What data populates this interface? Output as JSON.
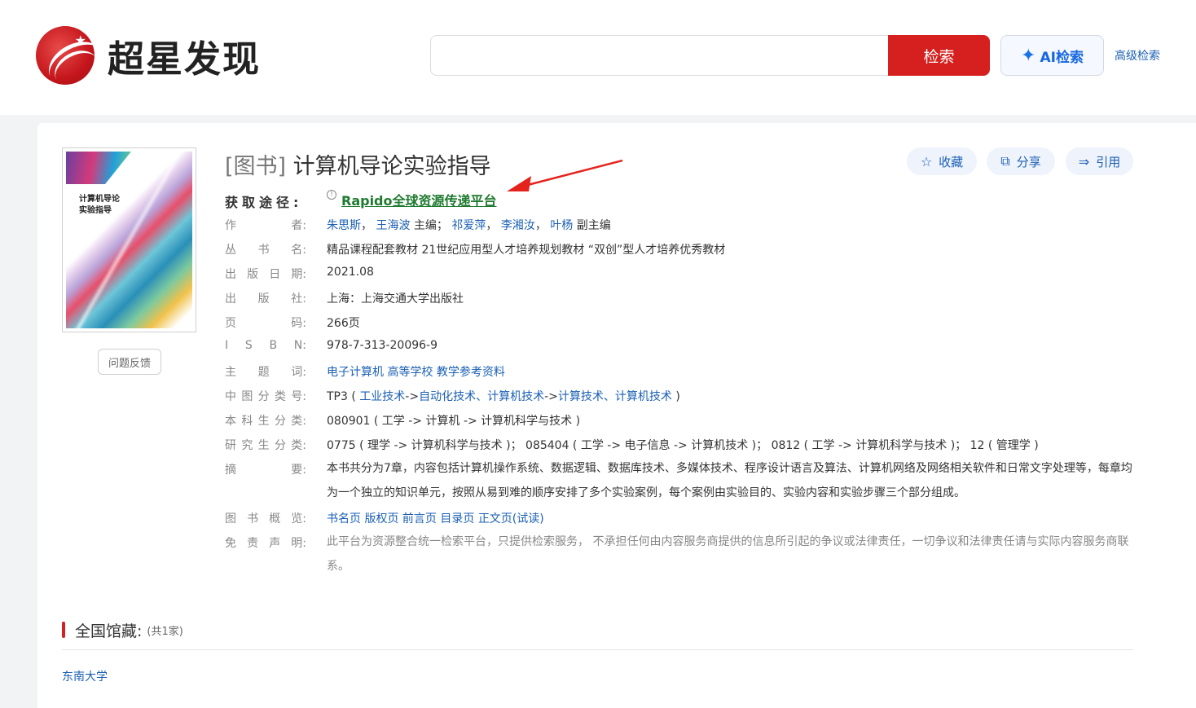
{
  "header": {
    "logo_text": "超星发现",
    "search_placeholder": "",
    "search_button": "检索",
    "ai_button": "AI检索",
    "advanced_link": "高级检索"
  },
  "book": {
    "type": "[图书]",
    "title": "计算机导论实验指导",
    "actions": {
      "favorite": "收藏",
      "share": "分享",
      "cite": "引用"
    },
    "access_label": "获取途径:",
    "access_link": "Rapido全球资源传递平台",
    "feedback_button": "问题反馈",
    "cover_title_line1": "计算机导论",
    "cover_title_line2": "实验指导",
    "fields": {
      "author_label": "作　者:",
      "authors": [
        {
          "name": "朱思斯",
          "sep": "，"
        },
        {
          "name": "王海波",
          "sep": " 主编；"
        },
        {
          "name": "祁爱萍",
          "sep": "，"
        },
        {
          "name": "李湘汝",
          "sep": "，"
        },
        {
          "name": "叶杨",
          "sep": " 副主编"
        }
      ],
      "series_label": "丛书名:",
      "series": "精品课程配套教材 21世纪应用型人才培养规划教材 “双创”型人才培养优秀教材",
      "date_label": "出版日期:",
      "date": "2021.08",
      "publisher_label": "出版社:",
      "publisher": "上海：上海交通大学出版社",
      "pages_label": "页码:",
      "pages": "266页",
      "isbn_label": "ISBN:",
      "isbn": "978-7-313-20096-9",
      "subject_label": "主题词:",
      "subjects": [
        "电子计算机",
        "高等学校",
        "教学参考资料"
      ],
      "clc_label": "中图分类号:",
      "clc_code": "TP3",
      "clc_parts": [
        "工业技术",
        "->",
        "自动化技术、计算机技术",
        "->",
        "计算技术、计算机技术"
      ],
      "ug_label": "本科生分类:",
      "ug": "080901 ( 工学 -> 计算机 -> 计算机科学与技术 )",
      "pg_label": "研究生分类:",
      "pg": "0775 ( 理学 -> 计算机科学与技术 )；  085404 ( 工学 -> 电子信息 -> 计算机技术 )；  0812 ( 工学 -> 计算机科学与技术 )；  12 ( 管理学 )",
      "abstract_label": "摘要:",
      "abstract": "本书共分为7章，内容包括计算机操作系统、数据逻辑、数据库技术、多媒体技术、程序设计语言及算法、计算机网络及网络相关软件和日常文字处理等，每章均为一个独立的知识单元，按照从易到难的顺序安排了多个实验案例，每个案例由实验目的、实验内容和实验步骤三个部分组成。",
      "preview_label": "图书概览:",
      "previews": [
        "书名页",
        "版权页",
        "前言页",
        "目录页",
        "正文页(试读)"
      ],
      "disclaimer_label": "免责声明:",
      "disclaimer": "此平台为资源整合统一检索平台，只提供检索服务，  不承担任何由内容服务商提供的信息所引起的争议或法律责任，一切争议和法律责任请与实际内容服务商联系。"
    }
  },
  "holdings": {
    "title": "全国馆藏:",
    "count": "(共1家)",
    "items": [
      "东南大学"
    ]
  },
  "colors": {
    "brand_red": "#d5201f",
    "link_blue": "#1a5fb4",
    "access_green": "#1d7a2e",
    "ai_blue": "#1667e0"
  }
}
